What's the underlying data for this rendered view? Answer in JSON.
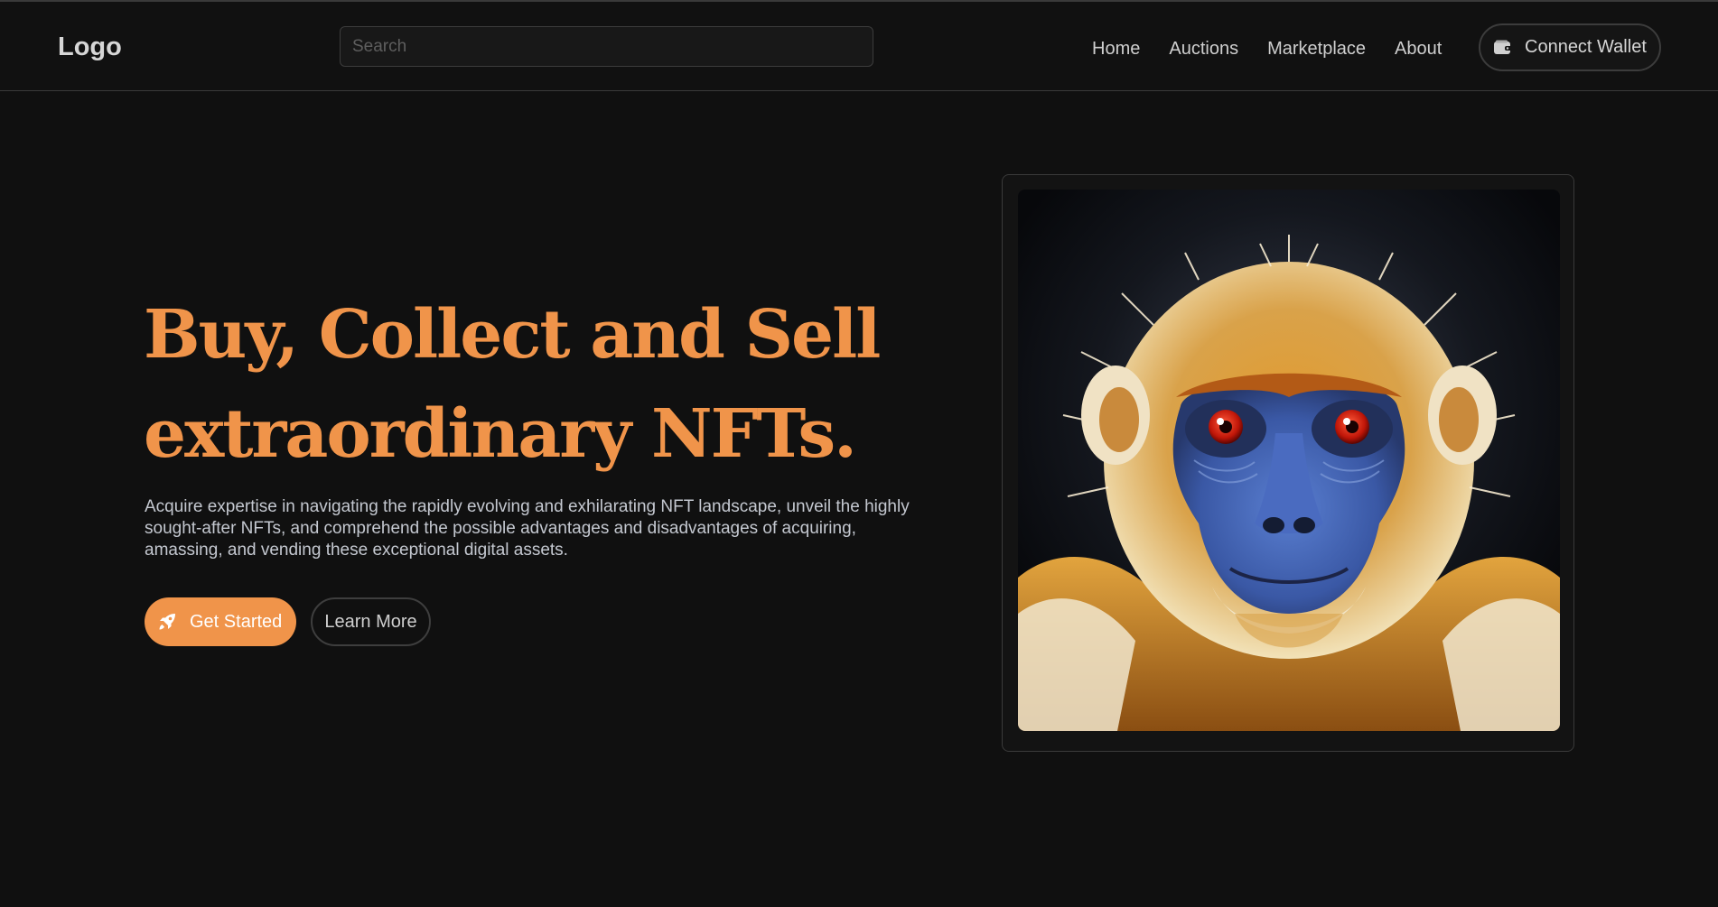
{
  "header": {
    "logo": "Logo",
    "search_placeholder": "Search",
    "nav": [
      "Home",
      "Auctions",
      "Marketplace",
      "About"
    ],
    "wallet_button": "Connect Wallet",
    "wallet_icon": "wallet-icon"
  },
  "hero": {
    "title_line1": "Buy, Collect and Sell",
    "title_line2": "extraordinary NFTs.",
    "description": "Acquire expertise in navigating the rapidly evolving and exhilarating NFT landscape, unveil the highly sought-after NFTs, and comprehend the possible advantages and disadvantages of acquiring, amassing, and vending these exceptional digital assets.",
    "primary_button": "Get Started",
    "primary_icon": "rocket-icon",
    "secondary_button": "Learn More"
  },
  "featured": {
    "image_subject": "monkey-portrait"
  },
  "colors": {
    "accent": "#f0944a",
    "background": "#101010",
    "border": "#3a3a3a"
  }
}
